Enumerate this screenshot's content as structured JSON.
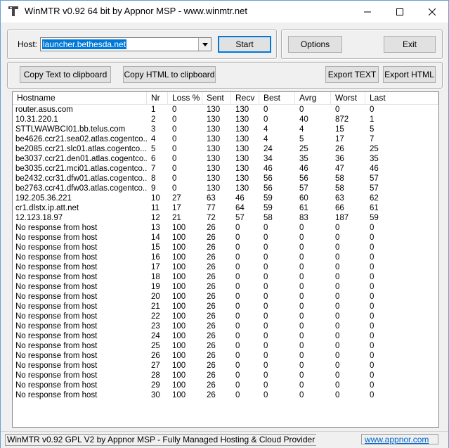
{
  "window": {
    "title": "WinMTR v0.92 64 bit by Appnor MSP - www.winmtr.net",
    "icons": {
      "app": "winmtr-app-icon",
      "minimize": "minimize-icon",
      "maximize": "maximize-icon",
      "close": "close-icon"
    }
  },
  "host": {
    "label": "Host:",
    "value": "launcher.bethesda.net"
  },
  "buttons": {
    "start": "Start",
    "options": "Options",
    "exit": "Exit",
    "copy_text": "Copy Text to clipboard",
    "copy_html": "Copy HTML to clipboard",
    "export_text": "Export TEXT",
    "export_html": "Export HTML"
  },
  "table": {
    "columns": [
      "Hostname",
      "Nr",
      "Loss %",
      "Sent",
      "Recv",
      "Best",
      "Avrg",
      "Worst",
      "Last"
    ],
    "rows": [
      [
        "router.asus.com",
        "1",
        "0",
        "130",
        "130",
        "0",
        "0",
        "0",
        "0"
      ],
      [
        "10.31.220.1",
        "2",
        "0",
        "130",
        "130",
        "0",
        "40",
        "872",
        "1"
      ],
      [
        "STTLWAWBCI01.bb.telus.com",
        "3",
        "0",
        "130",
        "130",
        "4",
        "4",
        "15",
        "5"
      ],
      [
        "be4626.ccr21.sea02.atlas.cogentco....",
        "4",
        "0",
        "130",
        "130",
        "4",
        "5",
        "17",
        "7"
      ],
      [
        "be2085.ccr21.slc01.atlas.cogentco....",
        "5",
        "0",
        "130",
        "130",
        "24",
        "25",
        "26",
        "25"
      ],
      [
        "be3037.ccr21.den01.atlas.cogentco....",
        "6",
        "0",
        "130",
        "130",
        "34",
        "35",
        "36",
        "35"
      ],
      [
        "be3035.ccr21.mci01.atlas.cogentco....",
        "7",
        "0",
        "130",
        "130",
        "46",
        "46",
        "47",
        "46"
      ],
      [
        "be2432.ccr31.dfw01.atlas.cogentco....",
        "8",
        "0",
        "130",
        "130",
        "56",
        "56",
        "58",
        "57"
      ],
      [
        "be2763.ccr41.dfw03.atlas.cogentco....",
        "9",
        "0",
        "130",
        "130",
        "56",
        "57",
        "58",
        "57"
      ],
      [
        "192.205.36.221",
        "10",
        "27",
        "63",
        "46",
        "59",
        "60",
        "63",
        "62"
      ],
      [
        "cr1.dlstx.ip.att.net",
        "11",
        "17",
        "77",
        "64",
        "59",
        "61",
        "66",
        "61"
      ],
      [
        "12.123.18.97",
        "12",
        "21",
        "72",
        "57",
        "58",
        "83",
        "187",
        "59"
      ],
      [
        "No response from host",
        "13",
        "100",
        "26",
        "0",
        "0",
        "0",
        "0",
        "0"
      ],
      [
        "No response from host",
        "14",
        "100",
        "26",
        "0",
        "0",
        "0",
        "0",
        "0"
      ],
      [
        "No response from host",
        "15",
        "100",
        "26",
        "0",
        "0",
        "0",
        "0",
        "0"
      ],
      [
        "No response from host",
        "16",
        "100",
        "26",
        "0",
        "0",
        "0",
        "0",
        "0"
      ],
      [
        "No response from host",
        "17",
        "100",
        "26",
        "0",
        "0",
        "0",
        "0",
        "0"
      ],
      [
        "No response from host",
        "18",
        "100",
        "26",
        "0",
        "0",
        "0",
        "0",
        "0"
      ],
      [
        "No response from host",
        "19",
        "100",
        "26",
        "0",
        "0",
        "0",
        "0",
        "0"
      ],
      [
        "No response from host",
        "20",
        "100",
        "26",
        "0",
        "0",
        "0",
        "0",
        "0"
      ],
      [
        "No response from host",
        "21",
        "100",
        "26",
        "0",
        "0",
        "0",
        "0",
        "0"
      ],
      [
        "No response from host",
        "22",
        "100",
        "26",
        "0",
        "0",
        "0",
        "0",
        "0"
      ],
      [
        "No response from host",
        "23",
        "100",
        "26",
        "0",
        "0",
        "0",
        "0",
        "0"
      ],
      [
        "No response from host",
        "24",
        "100",
        "26",
        "0",
        "0",
        "0",
        "0",
        "0"
      ],
      [
        "No response from host",
        "25",
        "100",
        "26",
        "0",
        "0",
        "0",
        "0",
        "0"
      ],
      [
        "No response from host",
        "26",
        "100",
        "26",
        "0",
        "0",
        "0",
        "0",
        "0"
      ],
      [
        "No response from host",
        "27",
        "100",
        "26",
        "0",
        "0",
        "0",
        "0",
        "0"
      ],
      [
        "No response from host",
        "28",
        "100",
        "26",
        "0",
        "0",
        "0",
        "0",
        "0"
      ],
      [
        "No response from host",
        "29",
        "100",
        "26",
        "0",
        "0",
        "0",
        "0",
        "0"
      ],
      [
        "No response from host",
        "30",
        "100",
        "26",
        "0",
        "0",
        "0",
        "0",
        "0"
      ]
    ]
  },
  "status": {
    "text": "WinMTR v0.92 GPL V2 by Appnor MSP - Fully Managed Hosting & Cloud Provider",
    "link": "www.appnor.com"
  },
  "colors": {
    "selection": "#0078d7",
    "link": "#0066cc",
    "button_face": "#e1e1e1"
  }
}
